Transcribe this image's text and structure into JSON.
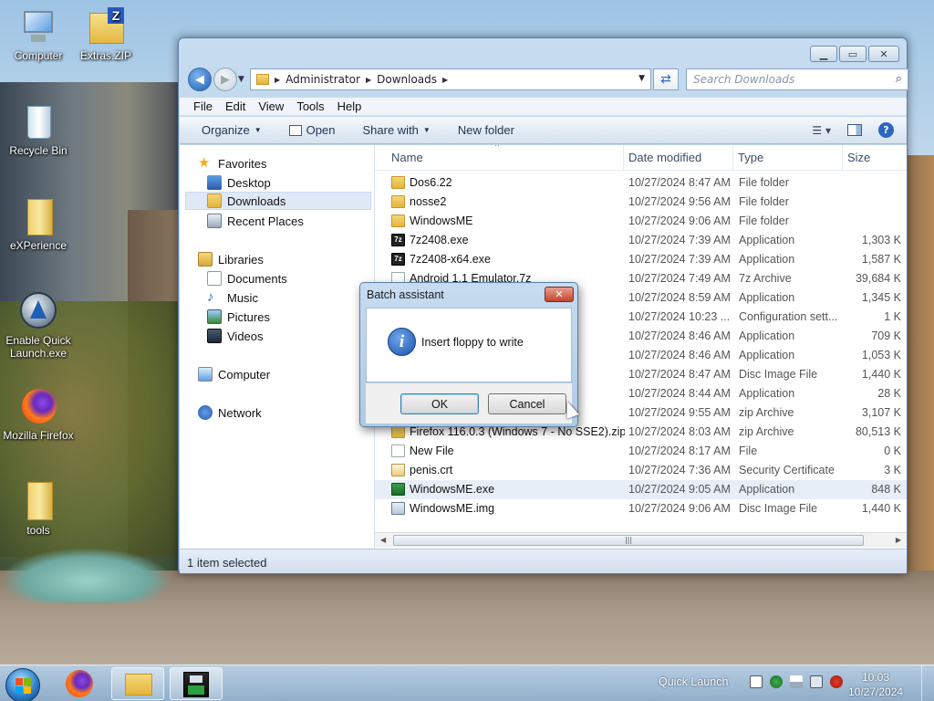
{
  "desktop": {
    "icons": [
      {
        "label": "Computer"
      },
      {
        "label": "Extras.ZIP"
      },
      {
        "label": "Recycle Bin"
      },
      {
        "label": "eXPerience"
      },
      {
        "label": "Enable Quick Launch.exe"
      },
      {
        "label": "Mozilla Firefox"
      },
      {
        "label": "tools"
      }
    ]
  },
  "explorer": {
    "breadcrumb": [
      "Administrator",
      "Downloads"
    ],
    "search_placeholder": "Search Downloads",
    "menu": [
      "File",
      "Edit",
      "View",
      "Tools",
      "Help"
    ],
    "toolbar": {
      "organize": "Organize",
      "open": "Open",
      "share_with": "Share with",
      "new_folder": "New folder"
    },
    "nav": {
      "favorites": "Favorites",
      "desktop": "Desktop",
      "downloads": "Downloads",
      "recent_places": "Recent Places",
      "libraries": "Libraries",
      "documents": "Documents",
      "music": "Music",
      "pictures": "Pictures",
      "videos": "Videos",
      "computer": "Computer",
      "network": "Network"
    },
    "columns": {
      "name": "Name",
      "date": "Date modified",
      "type": "Type",
      "size": "Size"
    },
    "files": [
      {
        "name": "Dos6.22",
        "date": "10/27/2024 8:47 AM",
        "type": "File folder",
        "size": ""
      },
      {
        "name": "nosse2",
        "date": "10/27/2024 9:56 AM",
        "type": "File folder",
        "size": ""
      },
      {
        "name": "WindowsME",
        "date": "10/27/2024 9:06 AM",
        "type": "File folder",
        "size": ""
      },
      {
        "name": "7z2408.exe",
        "date": "10/27/2024 7:39 AM",
        "type": "Application",
        "size": "1,303 K"
      },
      {
        "name": "7z2408-x64.exe",
        "date": "10/27/2024 7:39 AM",
        "type": "Application",
        "size": "1,587 K"
      },
      {
        "name": "Android 1.1 Emulator.7z",
        "date": "10/27/2024 7:49 AM",
        "type": "7z Archive",
        "size": "39,684 K"
      },
      {
        "name": "",
        "date": "10/27/2024 8:59 AM",
        "type": "Application",
        "size": "1,345 K"
      },
      {
        "name": "",
        "date": "10/27/2024 10:23 ...",
        "type": "Configuration sett...",
        "size": "1 K"
      },
      {
        "name": "",
        "date": "10/27/2024 8:46 AM",
        "type": "Application",
        "size": "709 K"
      },
      {
        "name": "",
        "date": "10/27/2024 8:46 AM",
        "type": "Application",
        "size": "1,053 K"
      },
      {
        "name": "",
        "date": "10/27/2024 8:47 AM",
        "type": "Disc Image File",
        "size": "1,440 K"
      },
      {
        "name": "",
        "date": "10/27/2024 8:44 AM",
        "type": "Application",
        "size": "28 K"
      },
      {
        "name": "",
        "date": "10/27/2024 9:55 AM",
        "type": "zip Archive",
        "size": "3,107 K"
      },
      {
        "name": "Firefox 116.0.3 (Windows 7 - No SSE2).zip",
        "date": "10/27/2024 8:03 AM",
        "type": "zip Archive",
        "size": "80,513 K"
      },
      {
        "name": "New File",
        "date": "10/27/2024 8:17 AM",
        "type": "File",
        "size": "0 K"
      },
      {
        "name": "penis.crt",
        "date": "10/27/2024 7:36 AM",
        "type": "Security Certificate",
        "size": "3 K"
      },
      {
        "name": "WindowsME.exe",
        "date": "10/27/2024 9:05 AM",
        "type": "Application",
        "size": "848 K"
      },
      {
        "name": "WindowsME.img",
        "date": "10/27/2024 9:06 AM",
        "type": "Disc Image File",
        "size": "1,440 K"
      }
    ],
    "status": "1 item selected"
  },
  "dialog": {
    "title": "Batch assistant",
    "message": "Insert floppy to write",
    "ok": "OK",
    "cancel": "Cancel"
  },
  "taskbar": {
    "quick_launch": "Quick Launch",
    "time": "10:03",
    "date": "10/27/2024"
  }
}
